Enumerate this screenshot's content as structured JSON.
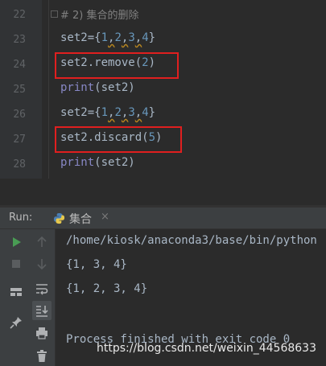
{
  "editor": {
    "lines": [
      {
        "num": "22",
        "comment": "# 2) 集合的删除"
      },
      {
        "num": "23",
        "var": "set2",
        "eq": "=",
        "open": "{",
        "items": [
          "1",
          "2",
          "3",
          "4"
        ],
        "close": "}"
      },
      {
        "num": "24",
        "call": "set2.remove(",
        "arg": "2",
        "end": ")"
      },
      {
        "num": "25",
        "call": "print(set2)"
      },
      {
        "num": "26",
        "var": "set2",
        "eq": "=",
        "open": "{",
        "items": [
          "1",
          "2",
          "3",
          "4"
        ],
        "close": "}"
      },
      {
        "num": "27",
        "call": "set2.discard(",
        "arg": "5",
        "end": ")"
      },
      {
        "num": "28",
        "call": "print(set2)"
      }
    ],
    "colors": {
      "keyword_print": "#8888c6",
      "number": "#6897bb",
      "comment": "#808080",
      "highlight_box": "#e01f1f"
    }
  },
  "run": {
    "label": "Run:",
    "tab_name": "集合",
    "tab_close": "×",
    "tab_icon": "python-icon",
    "toolbar": [
      "run-icon",
      "up-arrow-icon",
      "stop-icon",
      "down-arrow-icon",
      "layout-icon",
      "soft-wrap-icon",
      "scroll-to-end-icon",
      "pin-icon",
      "print-icon",
      "trash-icon"
    ]
  },
  "console": {
    "lines": [
      "/home/kiosk/anaconda3/base/bin/python",
      "{1, 3, 4}",
      "{1, 2, 3, 4}",
      "",
      "Process finished with exit code 0"
    ]
  },
  "watermark": "https://blog.csdn.net/weixin_44568633"
}
